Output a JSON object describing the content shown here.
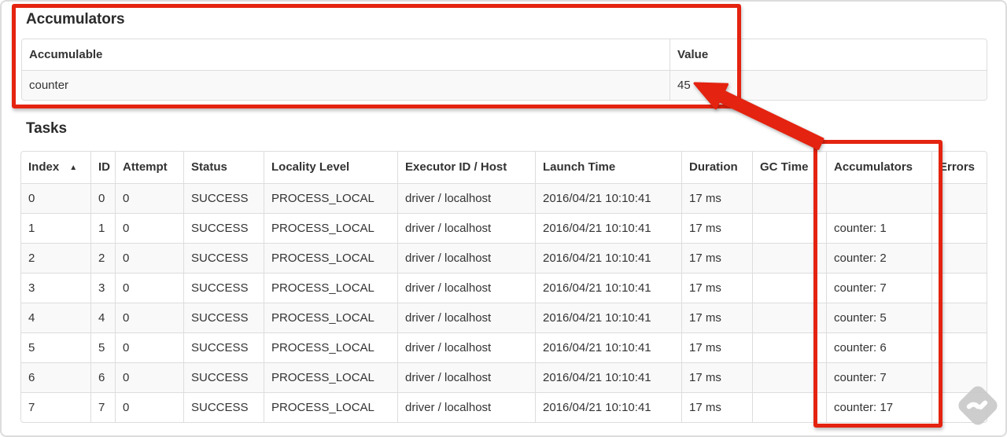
{
  "page": {
    "accumulators_section": {
      "title": "Accumulators",
      "table": {
        "headers": [
          "Accumulable",
          "Value"
        ],
        "row": {
          "accumulable": "counter",
          "value": "45"
        }
      }
    },
    "tasks_section": {
      "title": "Tasks",
      "table": {
        "sort_indicator": "▲",
        "headers": [
          "Index",
          "ID",
          "Attempt",
          "Status",
          "Locality Level",
          "Executor ID / Host",
          "Launch Time",
          "Duration",
          "GC Time",
          "Accumulators",
          "Errors"
        ],
        "rows": [
          {
            "index": "0",
            "id": "0",
            "attempt": "0",
            "status": "SUCCESS",
            "locality_level": "PROCESS_LOCAL",
            "executor_id_host": "driver / localhost",
            "launch_time": "2016/04/21 10:10:41",
            "duration": "17 ms",
            "gc_time": "",
            "accumulators": "",
            "errors": ""
          },
          {
            "index": "1",
            "id": "1",
            "attempt": "0",
            "status": "SUCCESS",
            "locality_level": "PROCESS_LOCAL",
            "executor_id_host": "driver / localhost",
            "launch_time": "2016/04/21 10:10:41",
            "duration": "17 ms",
            "gc_time": "",
            "accumulators": "counter: 1",
            "errors": ""
          },
          {
            "index": "2",
            "id": "2",
            "attempt": "0",
            "status": "SUCCESS",
            "locality_level": "PROCESS_LOCAL",
            "executor_id_host": "driver / localhost",
            "launch_time": "2016/04/21 10:10:41",
            "duration": "17 ms",
            "gc_time": "",
            "accumulators": "counter: 2",
            "errors": ""
          },
          {
            "index": "3",
            "id": "3",
            "attempt": "0",
            "status": "SUCCESS",
            "locality_level": "PROCESS_LOCAL",
            "executor_id_host": "driver / localhost",
            "launch_time": "2016/04/21 10:10:41",
            "duration": "17 ms",
            "gc_time": "",
            "accumulators": "counter: 7",
            "errors": ""
          },
          {
            "index": "4",
            "id": "4",
            "attempt": "0",
            "status": "SUCCESS",
            "locality_level": "PROCESS_LOCAL",
            "executor_id_host": "driver / localhost",
            "launch_time": "2016/04/21 10:10:41",
            "duration": "17 ms",
            "gc_time": "",
            "accumulators": "counter: 5",
            "errors": ""
          },
          {
            "index": "5",
            "id": "5",
            "attempt": "0",
            "status": "SUCCESS",
            "locality_level": "PROCESS_LOCAL",
            "executor_id_host": "driver / localhost",
            "launch_time": "2016/04/21 10:10:41",
            "duration": "17 ms",
            "gc_time": "",
            "accumulators": "counter: 6",
            "errors": ""
          },
          {
            "index": "6",
            "id": "6",
            "attempt": "0",
            "status": "SUCCESS",
            "locality_level": "PROCESS_LOCAL",
            "executor_id_host": "driver / localhost",
            "launch_time": "2016/04/21 10:10:41",
            "duration": "17 ms",
            "gc_time": "",
            "accumulators": "counter: 7",
            "errors": ""
          },
          {
            "index": "7",
            "id": "7",
            "attempt": "0",
            "status": "SUCCESS",
            "locality_level": "PROCESS_LOCAL",
            "executor_id_host": "driver / localhost",
            "launch_time": "2016/04/21 10:10:41",
            "duration": "17 ms",
            "gc_time": "",
            "accumulators": "counter: 17",
            "errors": ""
          }
        ]
      }
    },
    "annotations": {
      "accent_color": "#e42310"
    },
    "watermark_icon": "feedly-logo"
  }
}
